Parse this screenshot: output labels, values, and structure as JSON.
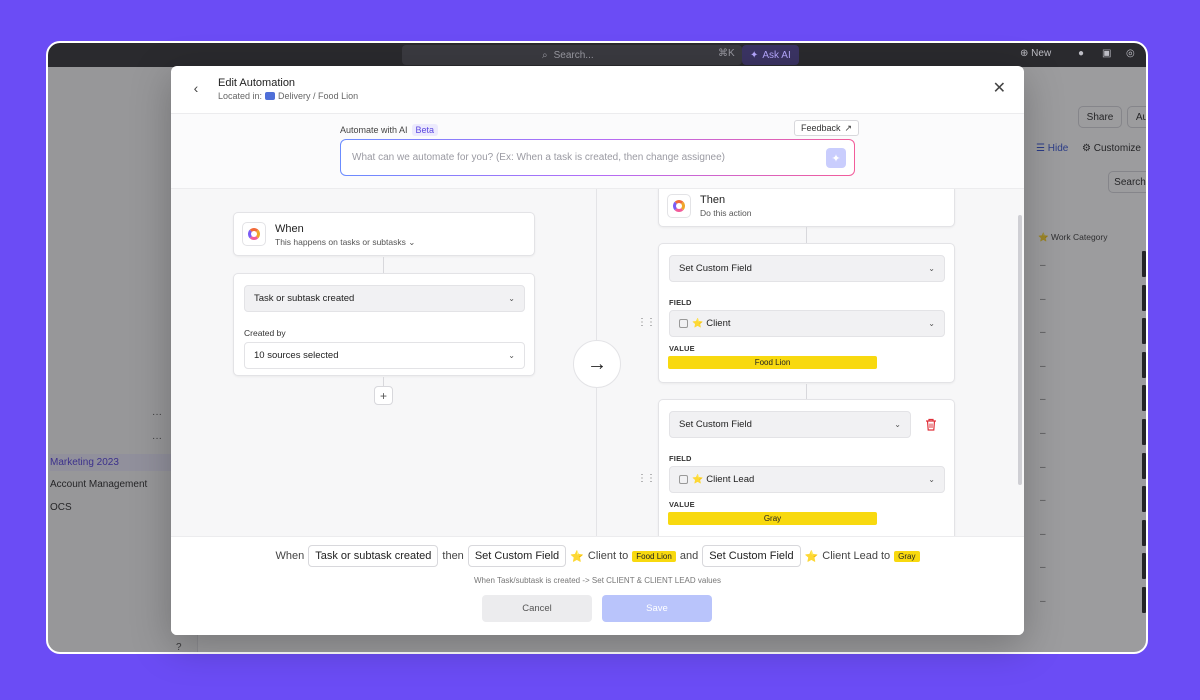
{
  "topbar": {
    "search_placeholder": "Search...",
    "shortcut": "⌘K",
    "ask_ai": "Ask AI",
    "new_label": "New"
  },
  "background": {
    "sidebar_items": [
      "Marketing 2023",
      "Account Management",
      "OCS"
    ],
    "share_label": "Share",
    "au_label": "Au",
    "hide_label": "Hide",
    "customize_label": "Customize",
    "search_label": "Search",
    "column_header": "Work Category",
    "row_value": "–"
  },
  "modal": {
    "title": "Edit Automation",
    "located_prefix": "Located in:",
    "location": "Delivery / Food Lion",
    "ai": {
      "label": "Automate with AI",
      "badge": "Beta",
      "feedback": "Feedback",
      "placeholder": "What can we automate for you? (Ex: When a task is created, then change assignee)"
    },
    "when": {
      "title": "When",
      "subtitle": "This happens on tasks or subtasks",
      "trigger": "Task or subtask created",
      "created_by_label": "Created by",
      "created_by_value": "10 sources selected"
    },
    "then": {
      "title": "Then",
      "subtitle": "Do this action",
      "actions": [
        {
          "action": "Set Custom Field",
          "field_label": "FIELD",
          "field": "Client",
          "value_label": "VALUE",
          "value": "Food Lion"
        },
        {
          "action": "Set Custom Field",
          "field_label": "FIELD",
          "field": "Client Lead",
          "value_label": "VALUE",
          "value": "Gray"
        }
      ]
    },
    "summary": {
      "when_word": "When",
      "trigger": "Task or subtask created",
      "then_word": "then",
      "action1": "Set Custom Field",
      "field1": "Client to",
      "value1": "Food Lion",
      "and_word": "and",
      "action2": "Set Custom Field",
      "field2": "Client Lead to",
      "value2": "Gray",
      "description": "When Task/subtask is created -> Set CLIENT & CLIENT LEAD values"
    },
    "buttons": {
      "cancel": "Cancel",
      "save": "Save"
    }
  },
  "colors": {
    "background": "#6b4cf5",
    "accent": "#5b47e0",
    "value_pill": "#f8d90f",
    "save_disabled": "#b9c4fb"
  }
}
